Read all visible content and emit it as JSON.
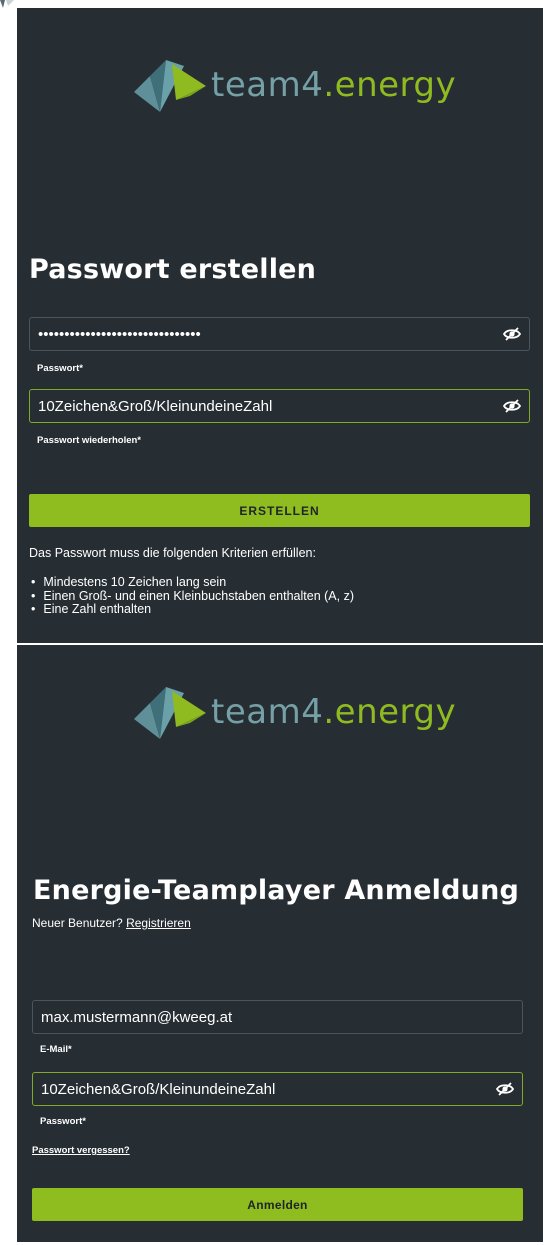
{
  "brand": {
    "logo_prefix": "team4",
    "logo_suffix": ".energy",
    "colors": {
      "background": "#262d33",
      "accent": "#8fbd1f",
      "logo_grey": "#74a0a6",
      "logo_green": "#8fbb21",
      "field_border": "#4c555d",
      "field_focus_border": "#7faa2a"
    }
  },
  "create_password": {
    "title": "Passwort erstellen",
    "password_value": "10Zeichen&Groß/KleinundeineZahl",
    "password_label": "Passwort*",
    "repeat_value": "10Zeichen&Groß/KleinundeineZahl",
    "repeat_label": "Passwort wiederholen*",
    "submit_label": "ERSTELLEN",
    "criteria_intro": "Das Passwort muss die folgenden Kriterien erfüllen:",
    "criteria": [
      "Mindestens 10 Zeichen lang sein",
      "Einen Groß- und einen Kleinbuchstaben enthalten (A, z)",
      "Eine Zahl enthalten"
    ]
  },
  "login": {
    "title": "Energie-Teamplayer Anmeldung",
    "new_user_text": "Neuer Benutzer?",
    "register_link": "Registrieren",
    "email_value": "max.mustermann@kweeg.at",
    "email_label": "E-Mail*",
    "password_value": "10Zeichen&Groß/KleinundeineZahl",
    "password_label": "Passwort*",
    "forgot_link": "Passwort vergessen?",
    "submit_label": "Anmelden"
  },
  "icons": {
    "visibility_toggle": "eye-off-icon",
    "logo": "team4-energy-logo-icon"
  }
}
